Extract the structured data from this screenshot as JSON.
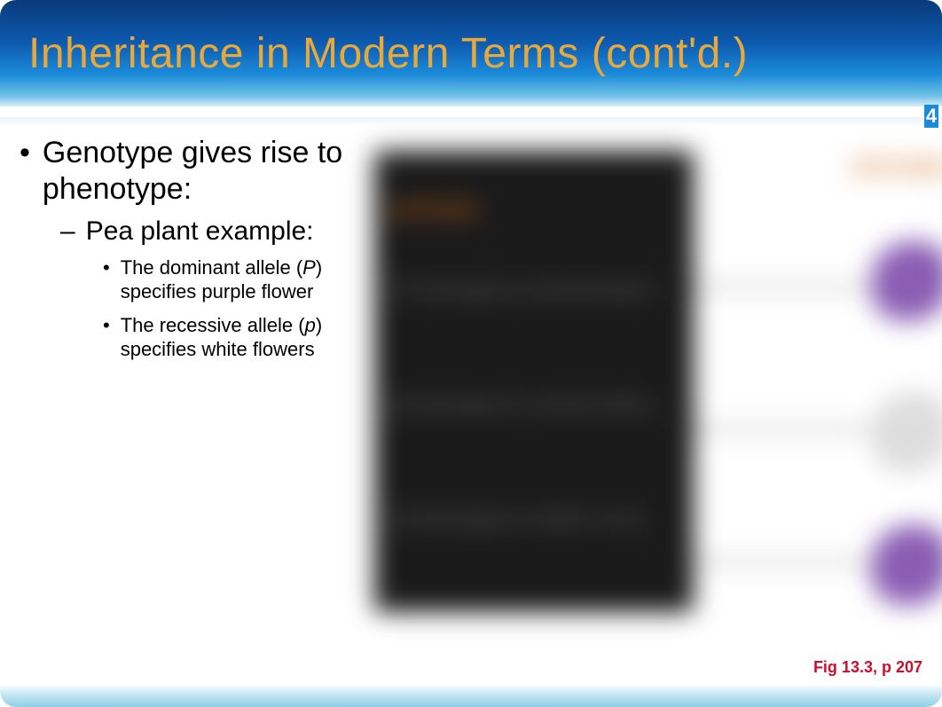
{
  "title": "Inheritance in Modern Terms (cont'd.)",
  "bullets": {
    "l1": "Genotype gives rise to phenotype:",
    "l2": "Pea plant example:",
    "l3a_pre": "The dominant allele (",
    "l3a_em": "P",
    "l3a_post": ") specifies purple flower",
    "l3b_pre": "The recessive allele (",
    "l3b_em": "p",
    "l3b_post": ") specifies white flowers"
  },
  "figure": {
    "header_left": "genotype",
    "header_right": "phenotype",
    "row1": "PP homozygous for dominant allele P",
    "row2": "pp homozygous for recessive allele p",
    "row3": "Pp heterozygous for alleles P and p",
    "caption": "Fig 13.3, p 207"
  },
  "page_marker": "4"
}
